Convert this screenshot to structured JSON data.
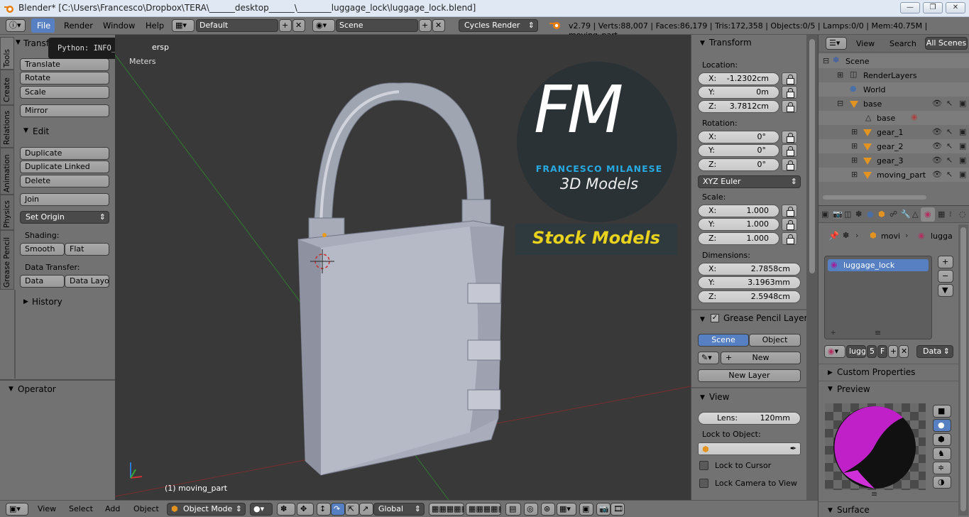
{
  "window": {
    "title": "Blender* [C:\\Users\\Francesco\\Dropbox\\TERA\\______desktop______\\________luggage_lock\\luggage_lock.blend]"
  },
  "menu": {
    "items": [
      "File",
      "Render",
      "Window",
      "Help"
    ],
    "layout": "Default",
    "scene": "Scene",
    "engine": "Cycles Render",
    "stats": "v2.79 | Verts:88,007 | Faces:86,179 | Tris:172,358 | Objects:0/5 | Lamps:0/0 | Mem:40.75M | moving_part"
  },
  "tooltip": {
    "text": "Python: INFO_MT_file"
  },
  "tool_tabs": [
    "Tools",
    "Create",
    "Relations",
    "Animation",
    "Physics",
    "Grease Pencil"
  ],
  "tools": {
    "transform_header": "Transform",
    "translate": "Translate",
    "rotate": "Rotate",
    "scale": "Scale",
    "mirror": "Mirror",
    "edit_header": "Edit",
    "duplicate": "Duplicate",
    "duplicate_linked": "Duplicate Linked",
    "delete": "Delete",
    "join": "Join",
    "set_origin": "Set Origin",
    "shading_label": "Shading:",
    "smooth": "Smooth",
    "flat": "Flat",
    "data_transfer_label": "Data Transfer:",
    "data": "Data",
    "data_layout": "Data Layo",
    "history_header": "History",
    "operator_header": "Operator"
  },
  "viewport": {
    "persp": "ersp",
    "units": "Meters",
    "active_object": "(1) moving_part"
  },
  "logo": {
    "letters": "FM",
    "name": "FRANCESCO MILANESE",
    "tagline": "3D Models",
    "banner": "Stock Models",
    "accent": "#27a9e1",
    "banner_color": "#e8d21d"
  },
  "properties_n": {
    "transform_header": "Transform",
    "location_label": "Location:",
    "loc": [
      {
        "axis": "X:",
        "value": "-1.2302cm"
      },
      {
        "axis": "Y:",
        "value": "0m"
      },
      {
        "axis": "Z:",
        "value": "3.7812cm"
      }
    ],
    "rotation_label": "Rotation:",
    "rot": [
      {
        "axis": "X:",
        "value": "0°"
      },
      {
        "axis": "Y:",
        "value": "0°"
      },
      {
        "axis": "Z:",
        "value": "0°"
      }
    ],
    "rotation_mode": "XYZ Euler",
    "scale_label": "Scale:",
    "scl": [
      {
        "axis": "X:",
        "value": "1.000"
      },
      {
        "axis": "Y:",
        "value": "1.000"
      },
      {
        "axis": "Z:",
        "value": "1.000"
      }
    ],
    "dimensions_label": "Dimensions:",
    "dim": [
      {
        "axis": "X:",
        "value": "2.7858cm"
      },
      {
        "axis": "Y:",
        "value": "3.1963mm"
      },
      {
        "axis": "Z:",
        "value": "2.5948cm"
      }
    ],
    "gp_header": "Grease Pencil Layers",
    "gp_scene": "Scene",
    "gp_object": "Object",
    "gp_new": "New",
    "gp_new_layer": "New Layer",
    "view_header": "View",
    "lens_label": "Lens:",
    "lens_value": "120mm",
    "lock_object_label": "Lock to Object:",
    "lock_cursor": "Lock to Cursor",
    "lock_camera": "Lock Camera to View"
  },
  "outliner": {
    "view": "View",
    "search": "Search",
    "all_scenes": "All Scenes",
    "items": [
      "Scene",
      "RenderLayers",
      "World",
      "base",
      "base",
      "gear_1",
      "gear_2",
      "gear_3",
      "moving_part"
    ]
  },
  "material": {
    "breadcrumb_obj": "movi",
    "breadcrumb_mat": "lugga",
    "slot": "luggage_lock",
    "mat_name": "lugg",
    "users": "5",
    "fake": "F",
    "link": "Data",
    "custom_props": "Custom Properties",
    "preview": "Preview",
    "surface": "Surface"
  },
  "footer": {
    "view": "View",
    "select": "Select",
    "add": "Add",
    "object": "Object",
    "mode": "Object Mode",
    "orientation": "Global"
  }
}
